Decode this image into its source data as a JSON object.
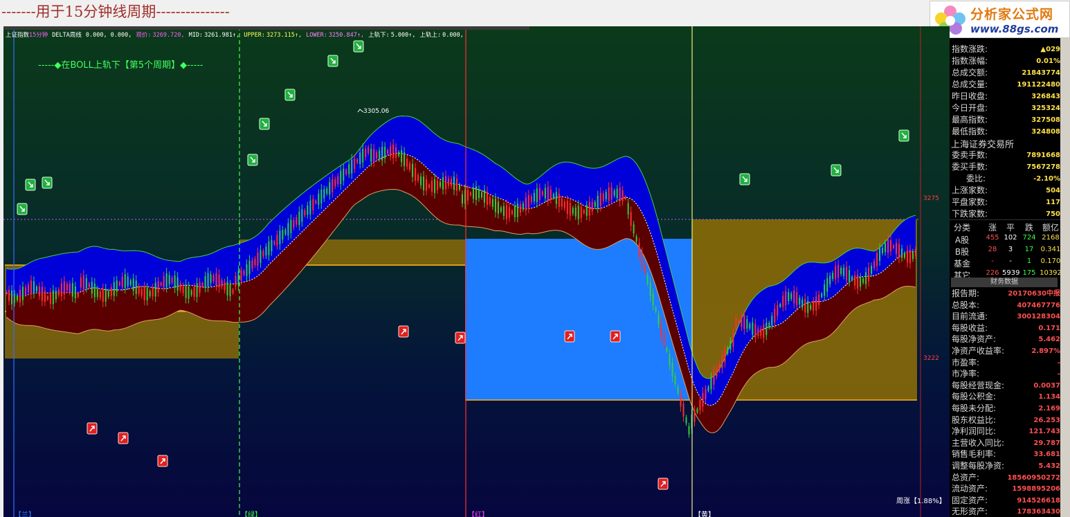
{
  "caption": "-------用于15分钟线周期---------------",
  "logo": {
    "line1": "分析家公式网",
    "line2": "www.88gs.com"
  },
  "infobar": {
    "name": "上证指数",
    "period": "15分钟",
    "indicator": "DELTA周线",
    "params": "0.000, 0.000,",
    "price_label": "现价:",
    "price": "3269.720,",
    "mid_label": "MID:",
    "mid": "3261.981↑,",
    "upper_label": "UPPER:",
    "upper": "3273.115↑,",
    "lower_label": "LOWER:",
    "lower": "3250.847↑,",
    "down_label": "上轨下:",
    "down": "5.000↑,",
    "up_label": "上轨上:",
    "up": "0.000,"
  },
  "annotation": "-----◆在BOLL上轨下【第5个周期】◆-----",
  "peak_label": "3305.06",
  "period_labels": [
    "【兰】",
    "【绿】",
    "【红】",
    "【黄】"
  ],
  "week_rise": "周涨【1.88%】",
  "axis_labels": [
    "3275",
    "3222"
  ],
  "colors": {
    "up": "#ff3030",
    "down": "#30d040",
    "blue_band": "#0000d8",
    "maroon_band": "#5a0000"
  },
  "sidebar": {
    "index_rows": [
      {
        "k": "指数涨跌:",
        "v": "▲029"
      },
      {
        "k": "指数涨幅:",
        "v": "0.01%"
      },
      {
        "k": "总成交额:",
        "v": "21843774"
      },
      {
        "k": "总成交量:",
        "v": "191122480"
      },
      {
        "k": "昨日收盘:",
        "v": "326843"
      },
      {
        "k": "今日开盘:",
        "v": "325324"
      },
      {
        "k": "最高指数:",
        "v": "327508"
      },
      {
        "k": "最低指数:",
        "v": "324808"
      }
    ],
    "exchange": "上海证券交易所",
    "order_rows": [
      {
        "k": "委卖手数:",
        "v": "7891668"
      },
      {
        "k": "委买手数:",
        "v": "7567278"
      },
      {
        "k": "委比:",
        "v": "-2.10%"
      },
      {
        "k": "上涨家数:",
        "v": "504"
      },
      {
        "k": "平盘家数:",
        "v": "117"
      },
      {
        "k": "下跌家数:",
        "v": "750"
      }
    ],
    "table_header": [
      "分类",
      "涨",
      "平",
      "跌",
      "额亿"
    ],
    "table_rows": [
      [
        "A股",
        "455",
        "102",
        "724",
        "2168"
      ],
      [
        "B股",
        "28",
        "3",
        "17",
        "0.341"
      ],
      [
        "基金",
        "-",
        "-",
        "1",
        "0.170"
      ],
      [
        "其它",
        "226",
        "5939",
        "175",
        "10392"
      ]
    ],
    "fin_button": "财务数据",
    "fin_rows": [
      {
        "k": "报告期:",
        "v": "20170630中报"
      },
      {
        "k": "总股本:",
        "v": "407467776"
      },
      {
        "k": "目前流通:",
        "v": "300128304"
      },
      {
        "k": "每股收益:",
        "v": "0.171"
      },
      {
        "k": "每股净资产:",
        "v": "5.462"
      },
      {
        "k": "净资产收益率:",
        "v": "2.897%"
      },
      {
        "k": "市盈率:",
        "v": "-"
      },
      {
        "k": "市净率:",
        "v": "-"
      },
      {
        "k": "每股经营现金:",
        "v": "0.0037"
      },
      {
        "k": "每股公积金:",
        "v": "1.134"
      },
      {
        "k": "每股未分配:",
        "v": "2.169"
      },
      {
        "k": "股东权益比:",
        "v": "26.253"
      },
      {
        "k": "净利润同比:",
        "v": "121.743"
      },
      {
        "k": "主营收入同比:",
        "v": "29.787"
      },
      {
        "k": "销售毛利率:",
        "v": "33.681"
      },
      {
        "k": "调整每股净资:",
        "v": "5.432"
      },
      {
        "k": "总资产:",
        "v": "18560950272"
      },
      {
        "k": "流动资产:",
        "v": "1598895206"
      },
      {
        "k": "固定资产:",
        "v": "914526618"
      },
      {
        "k": "无形资产:",
        "v": "178363430"
      }
    ]
  }
}
